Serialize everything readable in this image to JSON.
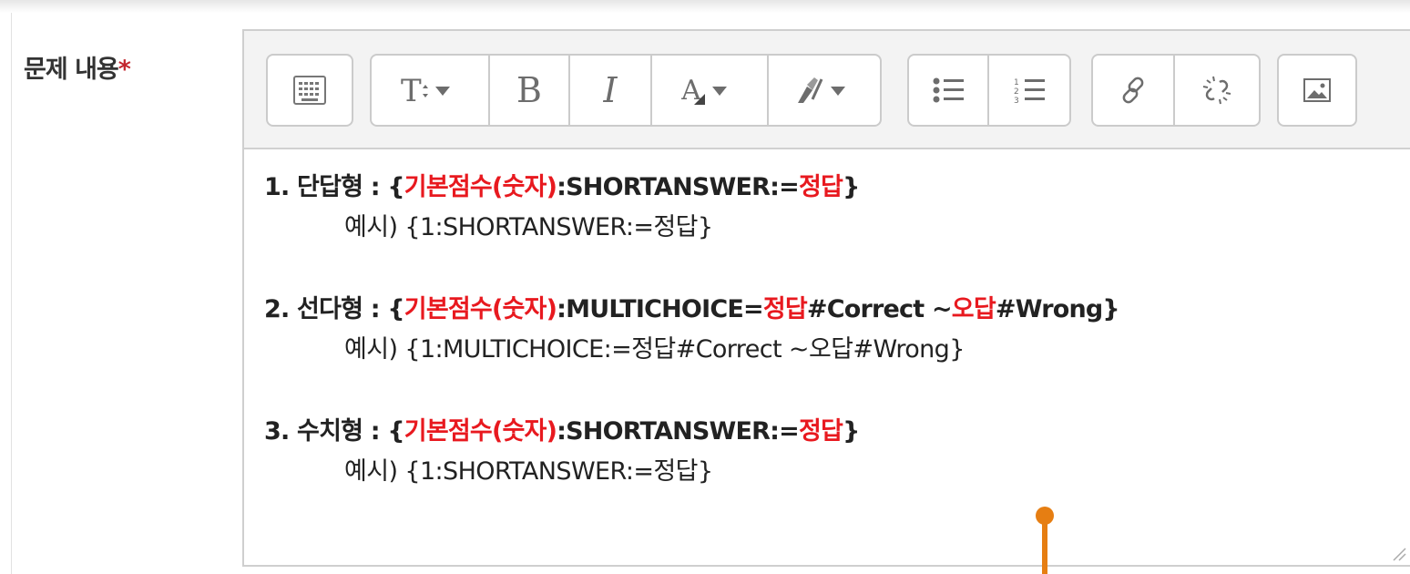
{
  "field": {
    "label": "문제 내용",
    "required_mark": "*"
  },
  "toolbar": {
    "groups": [
      {
        "buttons": [
          "toolbar-toggle-icon"
        ]
      },
      {
        "buttons": [
          "text-style-icon",
          "bold-icon",
          "italic-icon",
          "font-color-icon",
          "background-color-icon"
        ]
      },
      {
        "buttons": [
          "unordered-list-icon",
          "ordered-list-icon"
        ]
      },
      {
        "buttons": [
          "link-icon",
          "unlink-icon"
        ]
      },
      {
        "buttons": [
          "image-icon"
        ]
      }
    ],
    "bold_glyph": "B",
    "italic_glyph": "I"
  },
  "content": {
    "items": [
      {
        "prefix": "1. 단답형 : {",
        "red1": "기본점수(숫자)",
        "mid1": ":SHORTANSWER:=",
        "red2": "정답",
        "mid2": "}",
        "red3": "",
        "suffix": "",
        "example": "예시)  {1:SHORTANSWER:=정답}"
      },
      {
        "prefix": "2. 선다형 : {",
        "red1": "기본점수(숫자)",
        "mid1": ":MULTICHOICE=",
        "red2": "정답",
        "mid2": "#Correct ~",
        "red3": "오답",
        "suffix": "#Wrong}",
        "example": "예시)  {1:MULTICHOICE:=정답#Correct ~오답#Wrong}"
      },
      {
        "prefix": "3. 수치형 : {",
        "red1": "기본점수(숫자)",
        "mid1": ":SHORTANSWER:=",
        "red2": "정답",
        "mid2": "}",
        "red3": "",
        "suffix": "",
        "example": "예시)  {1:SHORTANSWER:=정답}"
      }
    ]
  },
  "colors": {
    "highlight": "#e8191f",
    "required": "#c3262e",
    "pointer": "#e67e12"
  }
}
